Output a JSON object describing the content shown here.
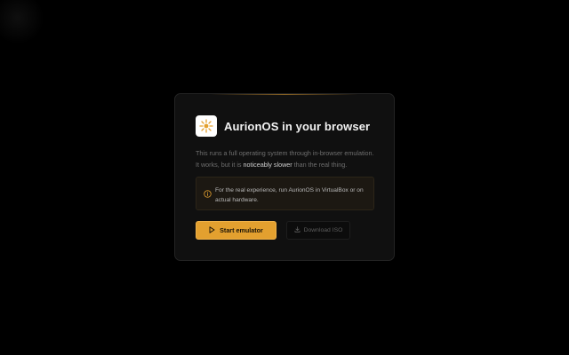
{
  "dialog": {
    "title": "AurionOS in your browser",
    "description": {
      "line1": "This runs a full operating system through in-browser emulation.",
      "line2_before": "It works, but it is ",
      "line2_highlight": "noticeably slower",
      "line2_after": " than the real thing."
    },
    "notice": {
      "icon": "info-circle-icon",
      "text": "For the real experience, run AurionOS in VirtualBox or on actual hardware."
    },
    "actions": {
      "start_label": "Start emulator",
      "start_icon": "play-icon",
      "download_label": "Download ISO",
      "download_icon": "download-icon"
    }
  },
  "colors": {
    "accent": "#e3a02f",
    "background": "#000000",
    "card": "#101010",
    "notice_bg": "#1c1812"
  }
}
